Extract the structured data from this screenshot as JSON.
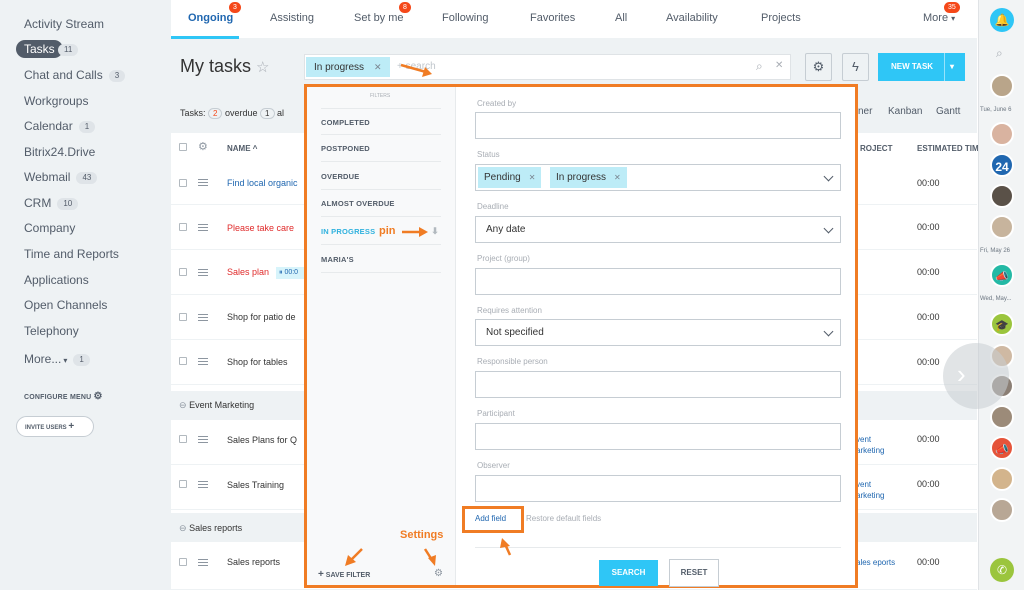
{
  "left_menu": {
    "items": [
      {
        "label": "Activity Stream"
      },
      {
        "label": "Tasks",
        "count": "11"
      },
      {
        "label": "Chat and Calls",
        "count": "3"
      },
      {
        "label": "Workgroups"
      },
      {
        "label": "Calendar",
        "count": "1"
      },
      {
        "label": "Bitrix24.Drive"
      },
      {
        "label": "Webmail",
        "count": "43"
      },
      {
        "label": "CRM",
        "count": "10"
      },
      {
        "label": "Company"
      },
      {
        "label": "Time and Reports"
      },
      {
        "label": "Applications"
      },
      {
        "label": "Open Channels"
      },
      {
        "label": "Telephony"
      },
      {
        "label": "More...",
        "count": "1"
      }
    ],
    "configure_menu": "CONFIGURE MENU",
    "invite_users": "INVITE USERS"
  },
  "tabs": [
    {
      "label": "Ongoing",
      "badge": "3"
    },
    {
      "label": "Assisting"
    },
    {
      "label": "Set by me",
      "badge": "8"
    },
    {
      "label": "Following"
    },
    {
      "label": "Favorites"
    },
    {
      "label": "All"
    },
    {
      "label": "Availability"
    },
    {
      "label": "Projects"
    },
    {
      "label": "More",
      "badge": "35"
    }
  ],
  "header": {
    "title": "My tasks",
    "search_chip": "In progress",
    "search_placeholder": "+ search",
    "new_task": "NEW TASK"
  },
  "counters": {
    "prefix": "Tasks:",
    "overdue_count": "2",
    "overdue_label": "overdue",
    "almost_count": "1",
    "almost_label": "al"
  },
  "views": [
    "ner",
    "Kanban",
    "Gantt"
  ],
  "table_headers": {
    "name": "NAME",
    "project": "ROJECT",
    "estimated": "ESTIMATED TIM"
  },
  "rows": [
    {
      "name": "Find local organic",
      "time": "00:00",
      "color": "#2067b0"
    },
    {
      "name": "Please take care",
      "time": "00:00",
      "color": "#e02b2b"
    },
    {
      "name": "Sales plan",
      "time": "00:00",
      "color": "#e02b2b",
      "chip": "00:0"
    },
    {
      "name": "Shop for patio de",
      "time": "00:00",
      "color": "#333333"
    },
    {
      "name": "Shop for tables",
      "time": "00:00",
      "color": "#333333"
    }
  ],
  "group1": "Event Marketing",
  "group1_rows": [
    {
      "name": "Sales Plans for Q",
      "time": "00:00",
      "project": "vent arketing"
    },
    {
      "name": "Sales Training",
      "time": "00:00",
      "project": "vent arketing"
    }
  ],
  "group2": "Sales reports",
  "group2_rows": [
    {
      "name": "Sales reports",
      "time": "00:00",
      "project": "ales eports"
    }
  ],
  "popup": {
    "filters_heading": "FILTERS",
    "filters": [
      "COMPLETED",
      "POSTPONED",
      "OVERDUE",
      "ALMOST OVERDUE",
      "IN PROGRESS",
      "MARIA'S"
    ],
    "save_filter": "SAVE FILTER",
    "fields": {
      "created_by": "Created by",
      "status": "Status",
      "status_chips": [
        "Pending",
        "In progress"
      ],
      "deadline": "Deadline",
      "deadline_value": "Any date",
      "project": "Project (group)",
      "requires_attention": "Requires attention",
      "requires_value": "Not specified",
      "responsible": "Responsible person",
      "participant": "Participant",
      "observer": "Observer"
    },
    "add_field": "Add field",
    "restore": "Restore default fields",
    "search_btn": "SEARCH",
    "reset_btn": "RESET"
  },
  "annotations": {
    "pin": "pin",
    "settings": "Settings"
  },
  "right_rail": {
    "dates": [
      "Tue, June 6",
      "Fri, May 26",
      "Wed, May..."
    ],
    "num_badge": "24"
  },
  "colors": {
    "accent": "#2fc6f6",
    "annotation": "#f07c24",
    "badge": "#f54819"
  }
}
